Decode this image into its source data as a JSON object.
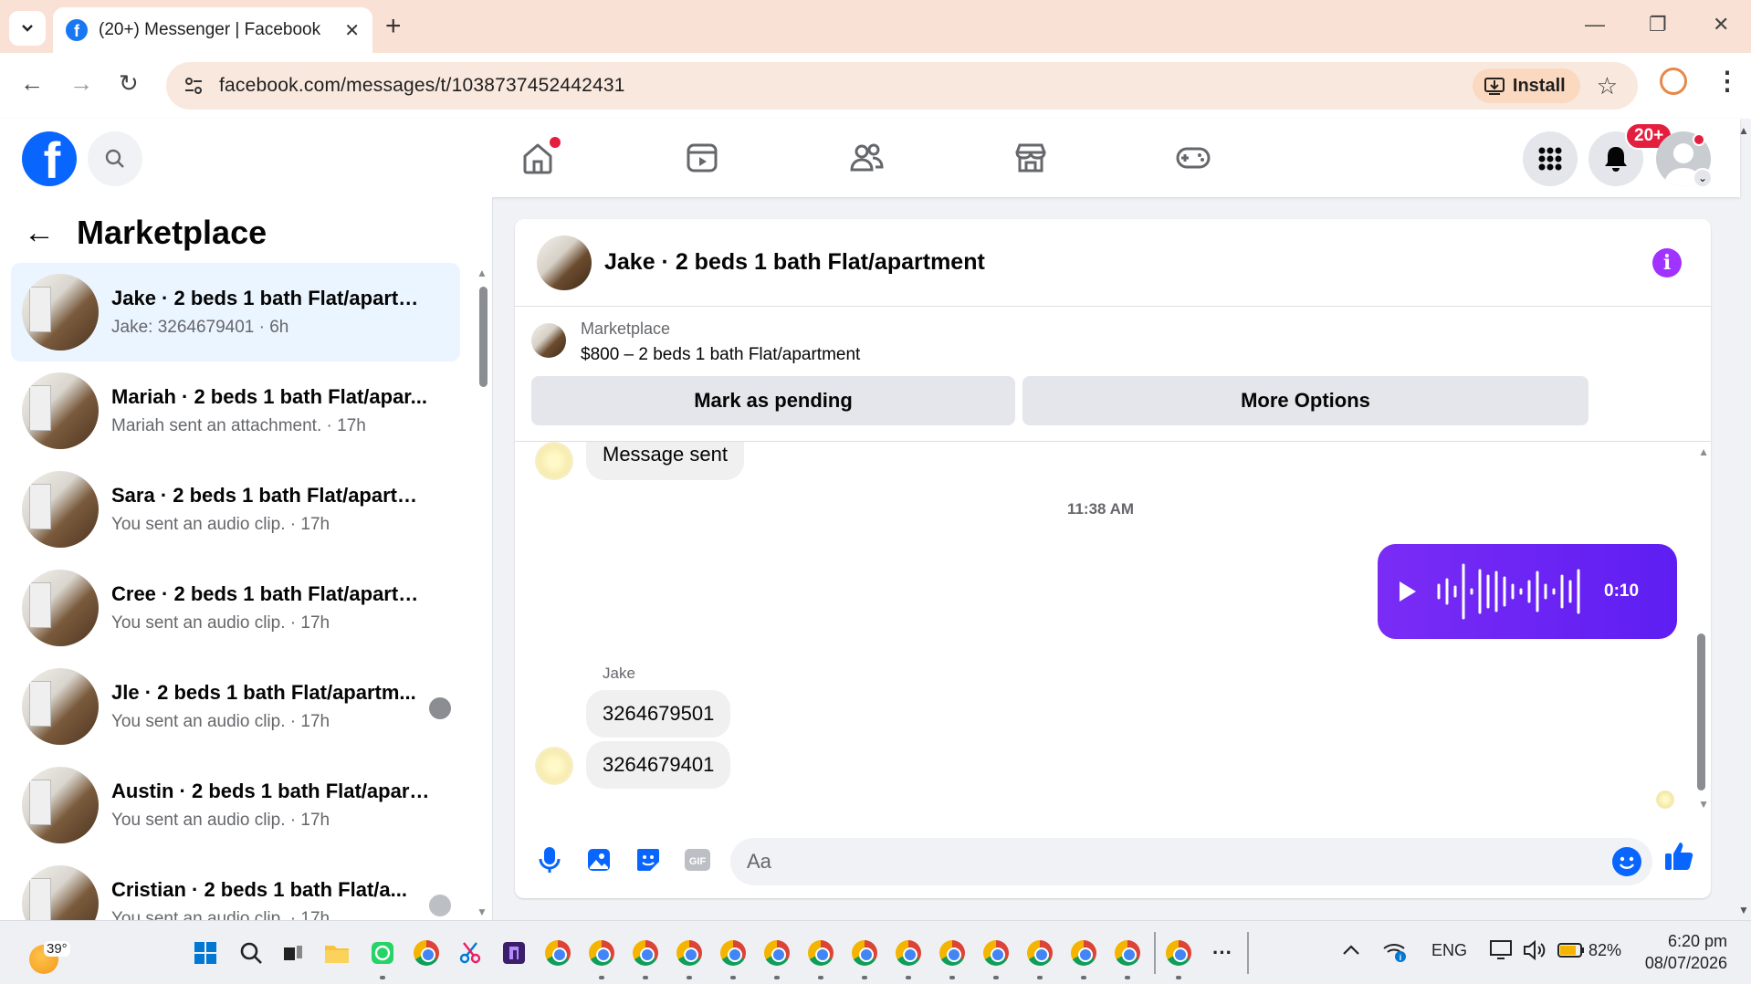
{
  "browser": {
    "tab_title": "(20+) Messenger | Facebook",
    "url": "facebook.com/messages/t/1038737452442431",
    "install_label": "Install"
  },
  "header": {
    "notification_badge": "20+"
  },
  "sidebar": {
    "title": "Marketplace",
    "conversations": [
      {
        "name": "Jake · 2 beds 1 bath Flat/apartm...",
        "preview": "Jake: 3264679401 · 6h",
        "active": true
      },
      {
        "name": "Mariah · 2 beds 1 bath Flat/apar...",
        "preview": "Mariah sent an attachment. · 17h"
      },
      {
        "name": "Sara · 2 beds 1 bath Flat/apartm...",
        "preview": "You sent an audio clip. · 17h"
      },
      {
        "name": "Cree · 2 beds 1 bath Flat/apartm...",
        "preview": "You sent an audio clip. · 17h"
      },
      {
        "name": "Jle · 2 beds 1 bath Flat/apartm...",
        "preview": "You sent an audio clip. · 17h"
      },
      {
        "name": "Austin · 2 beds 1 bath Flat/apart...",
        "preview": "You sent an audio clip. · 17h"
      },
      {
        "name": "Cristian · 2 beds 1 bath Flat/a...",
        "preview": "You sent an audio clip. · 17h"
      }
    ]
  },
  "chat": {
    "title": "Jake · 2 beds 1 bath Flat/apartment",
    "listing": {
      "source": "Marketplace",
      "description": "$800 – 2 beds 1 bath Flat/apartment",
      "mark_pending_label": "Mark as pending",
      "more_options_label": "More Options"
    },
    "messages": {
      "partial_bubble": "Message sent",
      "time_divider": "11:38 AM",
      "audio_duration": "0:10",
      "sender_name": "Jake",
      "received": [
        "3264679501",
        "3264679401"
      ]
    },
    "composer": {
      "placeholder": "Aa"
    }
  },
  "taskbar": {
    "temperature": "39°",
    "language": "ENG",
    "battery": "82%",
    "time": "6:20 pm",
    "date": "08/07/2026"
  }
}
